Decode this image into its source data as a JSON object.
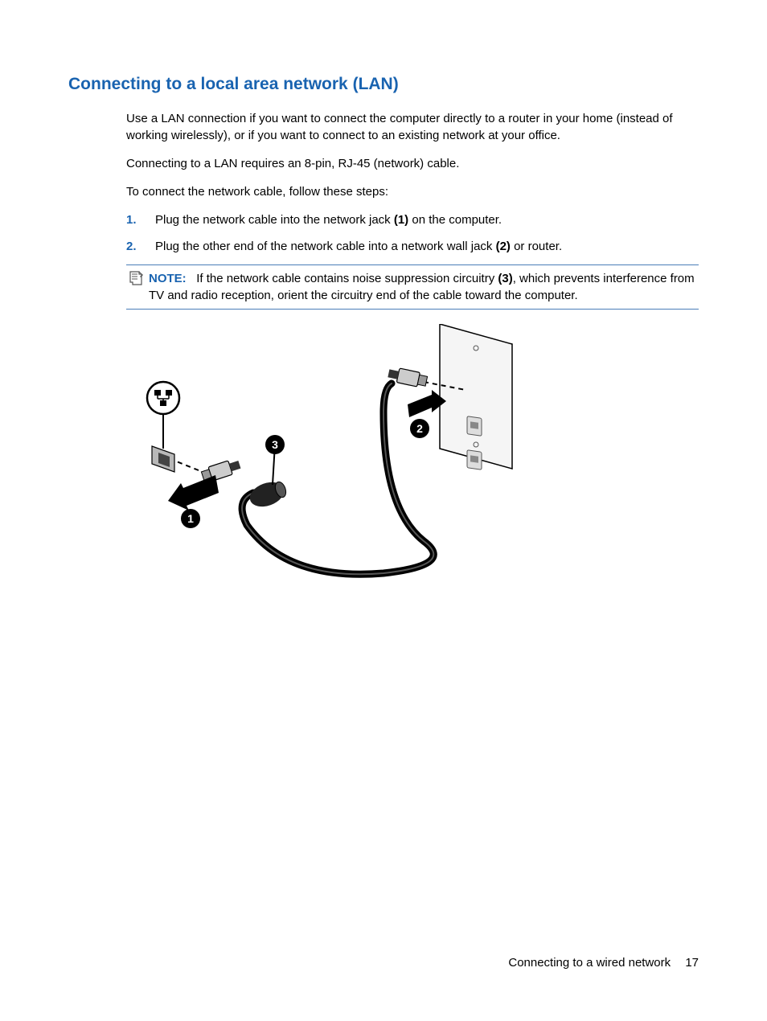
{
  "heading": "Connecting to a local area network (LAN)",
  "para_intro": "Use a LAN connection if you want to connect the computer directly to a router in your home (instead of working wirelessly), or if you want to connect to an existing network at your office.",
  "para_require": "Connecting to a LAN requires an 8-pin, RJ-45 (network) cable.",
  "para_steps_intro": "To connect the network cable, follow these steps:",
  "steps": [
    {
      "num": "1.",
      "text_before": "Plug the network cable into the network jack ",
      "bold": "(1)",
      "text_after": " on the computer."
    },
    {
      "num": "2.",
      "text_before": "Plug the other end of the network cable into a network wall jack ",
      "bold": "(2)",
      "text_after": " or router."
    }
  ],
  "note": {
    "label": "NOTE:",
    "text_before": "If the network cable contains noise suppression circuitry ",
    "bold": "(3)",
    "text_after": ", which prevents interference from TV and radio reception, orient the circuitry end of the cable toward the computer."
  },
  "diagram": {
    "labels": {
      "one": "1",
      "two": "2",
      "three": "3"
    }
  },
  "footer": {
    "section": "Connecting to a wired network",
    "page": "17"
  }
}
